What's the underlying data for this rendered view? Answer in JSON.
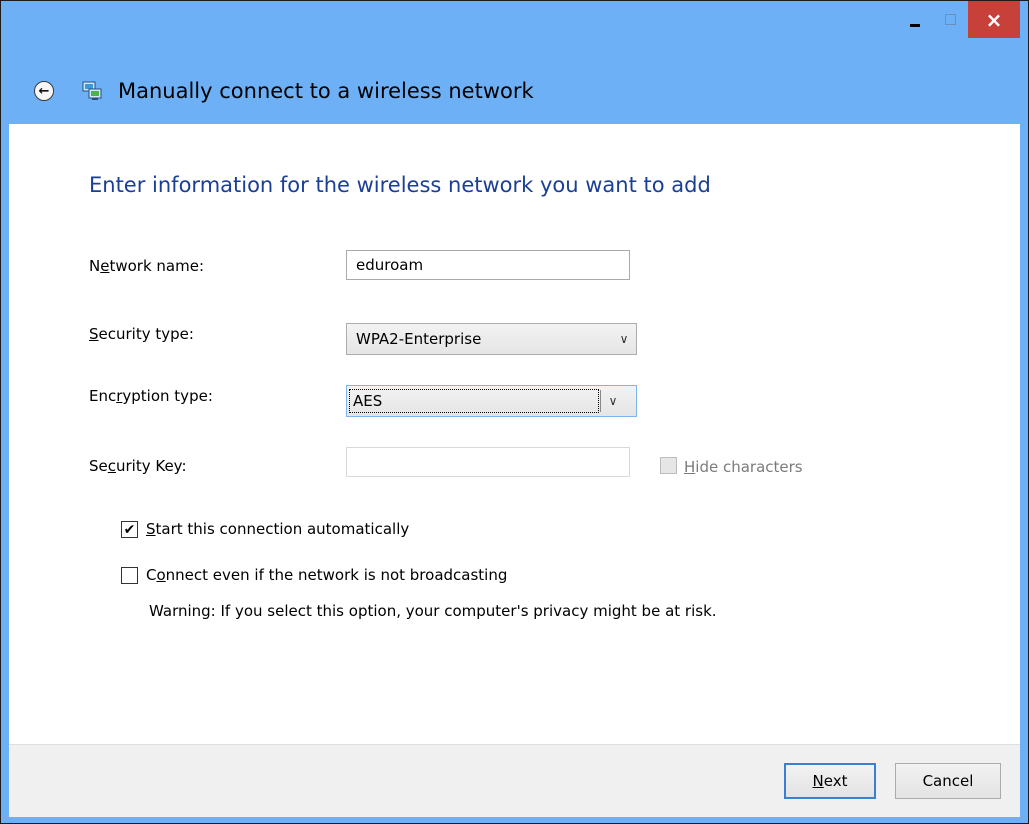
{
  "window": {
    "title": "Manually connect to a wireless network",
    "controls": {
      "minimize": "minimize-icon",
      "maximize": "maximize-icon",
      "close": "×"
    }
  },
  "header": {
    "back_icon": "back-arrow-icon",
    "network_icon": "network-icon"
  },
  "heading": "Enter information for the wireless network you want to add",
  "form": {
    "network_name": {
      "label_pre": "N",
      "label_ul": "e",
      "label_post": "twork name:",
      "value": "eduroam"
    },
    "security_type": {
      "label_pre": "",
      "label_ul": "S",
      "label_post": "ecurity type:",
      "value": "WPA2-Enterprise"
    },
    "encryption_type": {
      "label_pre": "Enc",
      "label_ul": "r",
      "label_post": "yption type:",
      "value": "AES"
    },
    "security_key": {
      "label_pre": "Se",
      "label_ul": "c",
      "label_post": "urity Key:",
      "value": ""
    },
    "hide_characters": {
      "label_pre": "",
      "label_ul": "H",
      "label_post": "ide characters",
      "checked": false,
      "enabled": false
    }
  },
  "options": {
    "start_auto": {
      "label_pre": "",
      "label_ul": "S",
      "label_post": "tart this connection automatically",
      "checked": true
    },
    "connect_hidden": {
      "label_pre": "C",
      "label_ul": "o",
      "label_post": "nnect even if the network is not broadcasting",
      "checked": false
    },
    "warning": "Warning: If you select this option, your computer's privacy might be at risk."
  },
  "footer": {
    "next": {
      "pre": "",
      "ul": "N",
      "post": "ext"
    },
    "cancel": "Cancel"
  },
  "colors": {
    "titlebar": "#6eb0f5",
    "close": "#c7403a",
    "heading": "#1a3f95",
    "default_button_border": "#3c7fd1"
  }
}
